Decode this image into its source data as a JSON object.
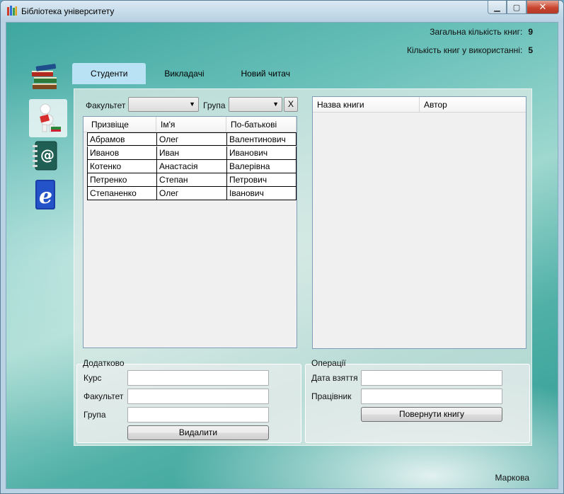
{
  "window": {
    "title": "Бібліотека університету",
    "controls": {
      "minimize": "▁",
      "maximize": "▢",
      "close": "✕"
    }
  },
  "stats": {
    "total_label": "Загальна кількість книг:",
    "total_value": "9",
    "in_use_label": "Кількість книг у використанні:",
    "in_use_value": "5"
  },
  "sidebar": {
    "icons": [
      "books-icon",
      "reader-icon",
      "address-book-icon",
      "e-book-icon"
    ],
    "active_index": 1
  },
  "tabs": [
    {
      "label": "Студенти",
      "active": true
    },
    {
      "label": "Викладачі",
      "active": false
    },
    {
      "label": "Новий читач",
      "active": false
    }
  ],
  "filters": {
    "faculty_label": "Факультет",
    "group_label": "Група",
    "clear_label": "X"
  },
  "students_table": {
    "columns": [
      "Призвіще",
      "Ім'я",
      "По-батькові"
    ],
    "rows": [
      [
        "Абрамов",
        "Олег",
        "Валентинович"
      ],
      [
        "Иванов",
        "Иван",
        "Иванович"
      ],
      [
        "Котенко",
        "Анастасія",
        "Валерівна"
      ],
      [
        "Петренко",
        "Степан",
        "Петрович"
      ],
      [
        "Степаненко",
        "Олег",
        "Іванович"
      ]
    ]
  },
  "books_table": {
    "columns": [
      "Назва книги",
      "Автор"
    ]
  },
  "extra": {
    "title": "Додатково",
    "course_label": "Курс",
    "faculty_label": "Факультет",
    "group_label": "Група",
    "delete_button": "Видалити"
  },
  "operations": {
    "title": "Операції",
    "date_label": "Дата взяття",
    "worker_label": "Працівник",
    "return_button": "Повернути книгу"
  },
  "footer": {
    "author": "Маркова"
  },
  "colors": {
    "tab_active": "#b9e2f5",
    "close_button": "#c9452f",
    "grid_border": "#7f9db9"
  }
}
